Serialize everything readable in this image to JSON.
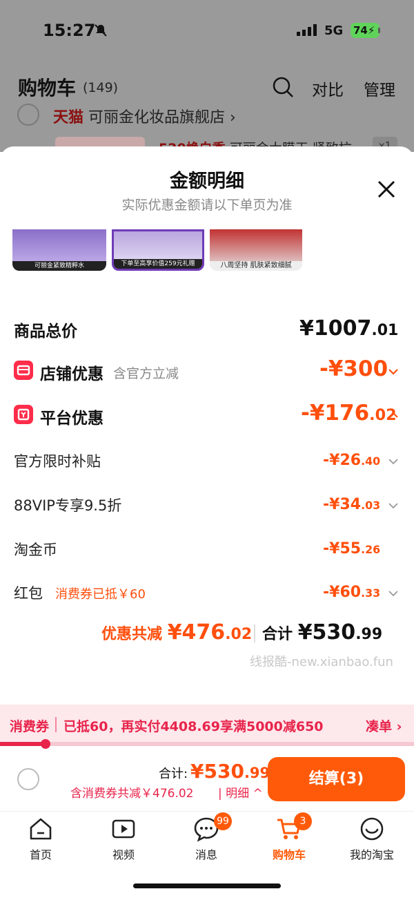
{
  "status": {
    "time": "15:27",
    "network": "5G",
    "battery": "74"
  },
  "cart": {
    "title": "购物车",
    "count": "(149)",
    "compare": "对比",
    "manage": "管理",
    "tmall": "天猫",
    "shop_name": "可丽金化妆品旗舰店 ›",
    "item_title_red": "520焕白季",
    "item_title": " 可丽金大膜王 紧致抗",
    "qty": "x1"
  },
  "sheet": {
    "title": "金额明细",
    "subtitle": "实际优惠金额请以下单页为准",
    "thumb_captions": [
      "可丽金紧致精粹水",
      "下单至高享价值259元礼赠",
      "八周坚持 肌肤紧致细腻"
    ],
    "total_label": "商品总价",
    "total_value": "¥1007",
    "total_cents": ".01",
    "shop_discount_label": "店铺优惠",
    "shop_discount_tag": "含官方立减",
    "shop_discount_value": "-¥300",
    "platform_discount_label": "平台优惠",
    "platform_discount_value": "-¥176",
    "platform_discount_cents": ".02",
    "sub_items": [
      {
        "label": "官方限时补贴",
        "value": "-¥26",
        "cents": ".40"
      },
      {
        "label": "88VIP专享9.5折",
        "value": "-¥34",
        "cents": ".03"
      },
      {
        "label": "淘金币",
        "value": "-¥55",
        "cents": ".26"
      },
      {
        "label": "红包",
        "value": "-¥60",
        "cents": ".33"
      }
    ],
    "coupon_note": "消费券已抵￥60",
    "summary_label": "优惠共减",
    "summary_value": "¥476",
    "summary_cents": ".02",
    "total_sum_label": "合计",
    "total_sum_value": "¥530",
    "total_sum_cents": ".99",
    "watermark": "线报酷-new.xianbao.fun"
  },
  "coupon_banner": {
    "label": "消费券",
    "text": "已抵60，再实付4408.69享满5000减650",
    "link": "凑单 ›",
    "progress": 0.11
  },
  "checkout": {
    "total_label": "合计:",
    "total_value": "¥530",
    "total_cents": ".99",
    "sub_text": "含消费券共减￥476.02",
    "detail": "| 明细 ^",
    "button": "结算(3)"
  },
  "tabs": [
    {
      "label": "首页",
      "icon": "home-icon"
    },
    {
      "label": "视频",
      "icon": "video-icon"
    },
    {
      "label": "消息",
      "icon": "message-icon",
      "badge": "99"
    },
    {
      "label": "购物车",
      "icon": "cart-icon",
      "badge": "3",
      "active": true
    },
    {
      "label": "我的淘宝",
      "icon": "profile-icon"
    }
  ],
  "colors": {
    "accent": "#ff5a0a",
    "discount": "#ff4f0d",
    "coupon": "#e8244b",
    "badge_red": "#ff2c4a"
  }
}
